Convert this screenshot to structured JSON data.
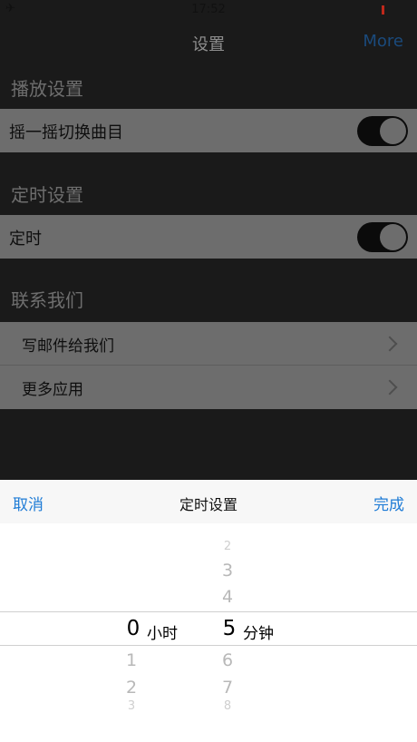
{
  "status_bar": {
    "time": "17:52",
    "airplane_icon": "airplane-icon"
  },
  "nav": {
    "title": "设置",
    "more_label": "More"
  },
  "sections": {
    "playback": {
      "header": "播放设置",
      "shake_label": "摇一摇切换曲目",
      "shake_on": true
    },
    "timer": {
      "header": "定时设置",
      "timer_label": "定时",
      "timer_on": true
    },
    "contact": {
      "header": "联系我们",
      "email_label": "写邮件给我们",
      "more_apps_label": "更多应用"
    }
  },
  "picker_sheet": {
    "cancel_label": "取消",
    "title": "定时设置",
    "done_label": "完成",
    "hours": {
      "selected": "0",
      "unit": "小时",
      "below": [
        "1",
        "2",
        "3"
      ]
    },
    "minutes": {
      "above": [
        "2",
        "3",
        "4"
      ],
      "selected": "5",
      "unit": "分钟",
      "below": [
        "6",
        "7",
        "8"
      ]
    }
  },
  "colors": {
    "accent": "#1f7cd6",
    "nav_more": "#1a4a7c",
    "battery": "#c0281b"
  }
}
